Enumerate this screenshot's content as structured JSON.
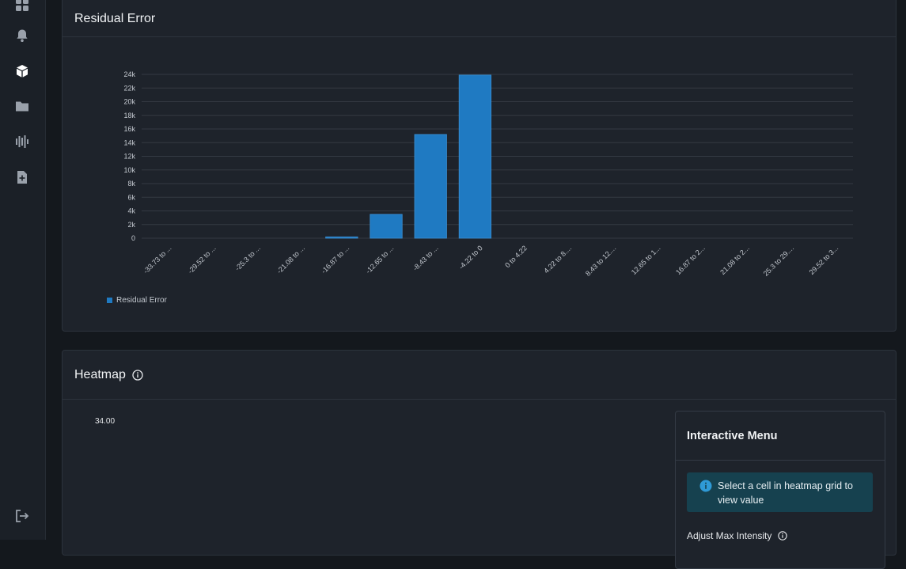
{
  "sidebar": {
    "icons": [
      "grid-icon",
      "bell-icon",
      "cube-icon",
      "folder-icon",
      "signal-icon",
      "file-plus-icon",
      "logout-icon"
    ],
    "active_icon": "cube-icon"
  },
  "residual_card": {
    "title": "Residual Error",
    "legend_label": "Residual Error"
  },
  "heatmap_card": {
    "title": "Heatmap",
    "scale_value": "34.00",
    "menu_title": "Interactive Menu",
    "info_message": "Select a cell in heatmap grid to view value",
    "intensity_label": "Adjust Max Intensity"
  },
  "colors": {
    "bar": "#1f7ac2",
    "info_bg": "#16414f",
    "info_icon": "#2f9ad6"
  },
  "chart_data": {
    "type": "bar",
    "categories": [
      "-33.73 to ...",
      "-29.52 to ...",
      "-25.3 to ...",
      "-21.08 to ...",
      "-16.87 to ...",
      "-12.65 to ...",
      "-8.43 to ...",
      "-4.22 to 0",
      "0 to 4.22",
      "4.22 to 8....",
      "8.43 to 12....",
      "12.65 to 1...",
      "16.87 to 2...",
      "21.08 to 2...",
      "25.3 to 29....",
      "29.52 to 3..."
    ],
    "series": [
      {
        "name": "Residual Error",
        "values": [
          0,
          0,
          0,
          0,
          200,
          3500,
          15200,
          23900,
          0,
          0,
          0,
          0,
          0,
          0,
          0,
          0
        ]
      }
    ],
    "yticks": [
      0,
      2000,
      4000,
      6000,
      8000,
      10000,
      12000,
      14000,
      16000,
      18000,
      20000,
      22000,
      24000
    ],
    "yticklabels": [
      "0",
      "2k",
      "4k",
      "6k",
      "8k",
      "10k",
      "12k",
      "14k",
      "16k",
      "18k",
      "20k",
      "22k",
      "24k"
    ],
    "ylim": [
      0,
      24000
    ],
    "grid": true,
    "legend": "bottom-left"
  }
}
